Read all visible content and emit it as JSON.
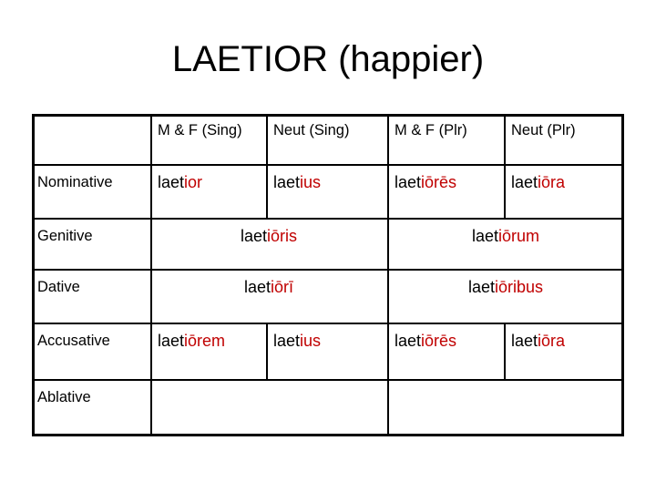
{
  "title": "LAETIOR (happier)",
  "accent_color": "#C00000",
  "table": {
    "headers": [
      "",
      "M & F (Sing)",
      "Neut (Sing)",
      "M & F (Plr)",
      "Neut (Plr)"
    ],
    "rows": [
      {
        "case": "Nominative",
        "forms": [
          {
            "stem": "laet",
            "ending": "ior",
            "span": 1
          },
          {
            "stem": "laet",
            "ending": "ius",
            "span": 1
          },
          {
            "stem": "laet",
            "ending": "iōrēs",
            "span": 1
          },
          {
            "stem": "laet",
            "ending": "iōra",
            "span": 1
          }
        ]
      },
      {
        "case": "Genitive",
        "forms": [
          {
            "stem": "laet",
            "ending": "iōris",
            "span": 2
          },
          {
            "stem": "laet",
            "ending": "iōrum",
            "span": 2
          }
        ]
      },
      {
        "case": "Dative",
        "forms": [
          {
            "stem": "laet",
            "ending": "iōrī",
            "span": 2
          },
          {
            "stem": "laet",
            "ending": "iōribus",
            "span": 2
          }
        ]
      },
      {
        "case": "Accusative",
        "forms": [
          {
            "stem": "laet",
            "ending": "iōrem",
            "span": 1
          },
          {
            "stem": "laet",
            "ending": "ius",
            "span": 1
          },
          {
            "stem": "laet",
            "ending": "iōrēs",
            "span": 1
          },
          {
            "stem": "laet",
            "ending": "iōra",
            "span": 1
          }
        ]
      },
      {
        "case": "Ablative",
        "forms": [
          {
            "stem": "",
            "ending": "",
            "span": 2
          },
          {
            "stem": "",
            "ending": "",
            "span": 2
          }
        ]
      }
    ]
  }
}
